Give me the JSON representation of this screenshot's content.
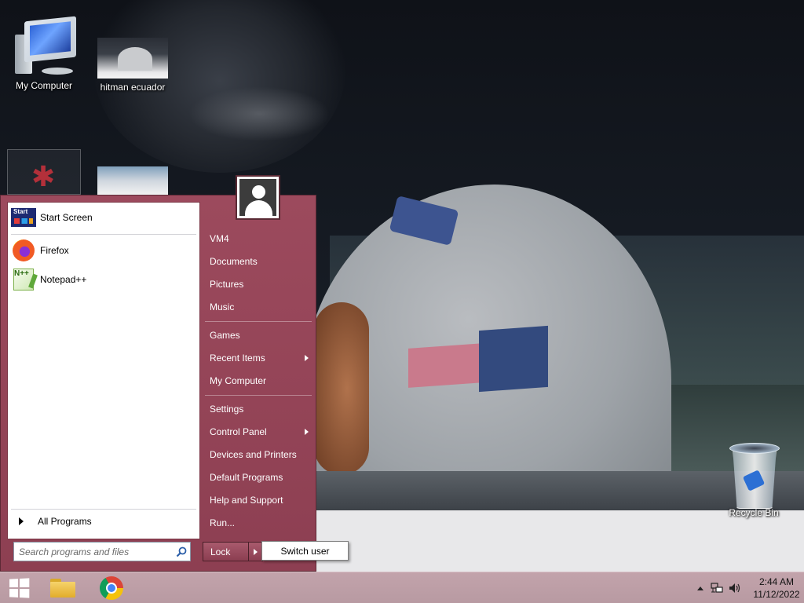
{
  "desktop": {
    "icons": [
      {
        "label": "My Computer",
        "icon": "computer-icon"
      },
      {
        "label": "hitman ecuador",
        "icon": "image-thumbnail-icon"
      },
      {
        "label": "",
        "icon": "app-icon"
      },
      {
        "label": "",
        "icon": "image-thumbnail-icon"
      },
      {
        "label": "Recycle Bin",
        "icon": "recycle-bin-icon"
      }
    ]
  },
  "start_menu": {
    "programs": [
      {
        "label": "Start Screen",
        "icon": "start-screen-icon",
        "icon_text": "Start"
      },
      {
        "label": "Firefox",
        "icon": "firefox-icon"
      },
      {
        "label": "Notepad++",
        "icon": "notepad-plus-plus-icon",
        "icon_text": "N++"
      }
    ],
    "all_programs": "All Programs",
    "search_placeholder": "Search programs and files",
    "user_icon": "user-avatar-icon",
    "right_items": [
      {
        "label": "VM4",
        "submenu": false
      },
      {
        "label": "Documents",
        "submenu": false
      },
      {
        "label": "Pictures",
        "submenu": false
      },
      {
        "label": "Music",
        "submenu": false
      },
      {
        "label": "Games",
        "submenu": false
      },
      {
        "label": "Recent Items",
        "submenu": true
      },
      {
        "label": "My Computer",
        "submenu": false
      },
      {
        "label": "Settings",
        "submenu": false
      },
      {
        "label": "Control Panel",
        "submenu": true
      },
      {
        "label": "Devices and Printers",
        "submenu": false
      },
      {
        "label": "Default Programs",
        "submenu": false
      },
      {
        "label": "Help and Support",
        "submenu": false
      },
      {
        "label": "Run...",
        "submenu": false
      }
    ],
    "lock_label": "Lock",
    "switch_user_label": "Switch user",
    "accent_color": "#96455a"
  },
  "taskbar": {
    "apps": [
      {
        "name": "start-button",
        "icon": "windows-logo-icon"
      },
      {
        "name": "file-explorer",
        "icon": "folder-icon"
      },
      {
        "name": "chrome",
        "icon": "chrome-icon"
      }
    ],
    "tray": {
      "icons": [
        "show-hidden-icons-icon",
        "network-icon",
        "volume-icon"
      ]
    },
    "clock": {
      "time": "2:44 AM",
      "date": "11/12/2022"
    }
  }
}
